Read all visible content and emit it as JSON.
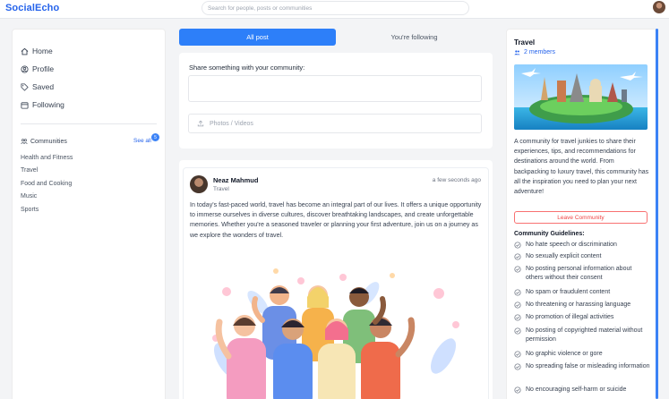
{
  "header": {
    "logo": "SocialEcho",
    "search_placeholder": "Search for people, posts or communities"
  },
  "sidebar": {
    "nav": [
      {
        "label": "Home",
        "icon": "home-icon"
      },
      {
        "label": "Profile",
        "icon": "profile-icon"
      },
      {
        "label": "Saved",
        "icon": "tag-icon"
      },
      {
        "label": "Following",
        "icon": "following-icon"
      }
    ],
    "communities_title": "Communities",
    "see_all": "See all",
    "badge_count": "5",
    "communities": [
      "Health and Fitness",
      "Travel",
      "Food and Cooking",
      "Music",
      "Sports"
    ]
  },
  "tabs": {
    "all": "All post",
    "following": "You're following"
  },
  "composer": {
    "label": "Share something with your community:",
    "photo_label": "Photos / Videos"
  },
  "post": {
    "author": "Neaz Mahmud",
    "community": "Travel",
    "time": "a few seconds ago",
    "text": "In today's fast-paced world, travel has become an integral part of our lives. It offers a unique opportunity to immerse ourselves in diverse cultures, discover breathtaking landscapes, and create unforgettable memories. Whether you're a seasoned traveler or planning your first adventure, join us on a journey as we explore the wonders of travel."
  },
  "community_panel": {
    "title": "Travel",
    "members": "2 members",
    "description": "A community for travel junkies to share their experiences, tips, and recommendations for destinations around the world. From backpacking to luxury travel, this community has all the inspiration you need to plan your next adventure!",
    "leave_label": "Leave Community",
    "guidelines_title": "Community Guidelines:",
    "guidelines": [
      "No hate speech or discrimination",
      "No sexually explicit content",
      "No posting personal information about others without their consent",
      "No spam or fraudulent content",
      "No threatening or harassing language",
      "No promotion of illegal activities",
      "No posting of copyrighted material without permission",
      "No graphic violence or gore",
      "No spreading false or misleading information",
      "No encouraging self-harm or suicide"
    ]
  },
  "colors": {
    "brand": "#2563eb",
    "active_tab": "#2d7ff9",
    "danger": "#ef4444"
  }
}
